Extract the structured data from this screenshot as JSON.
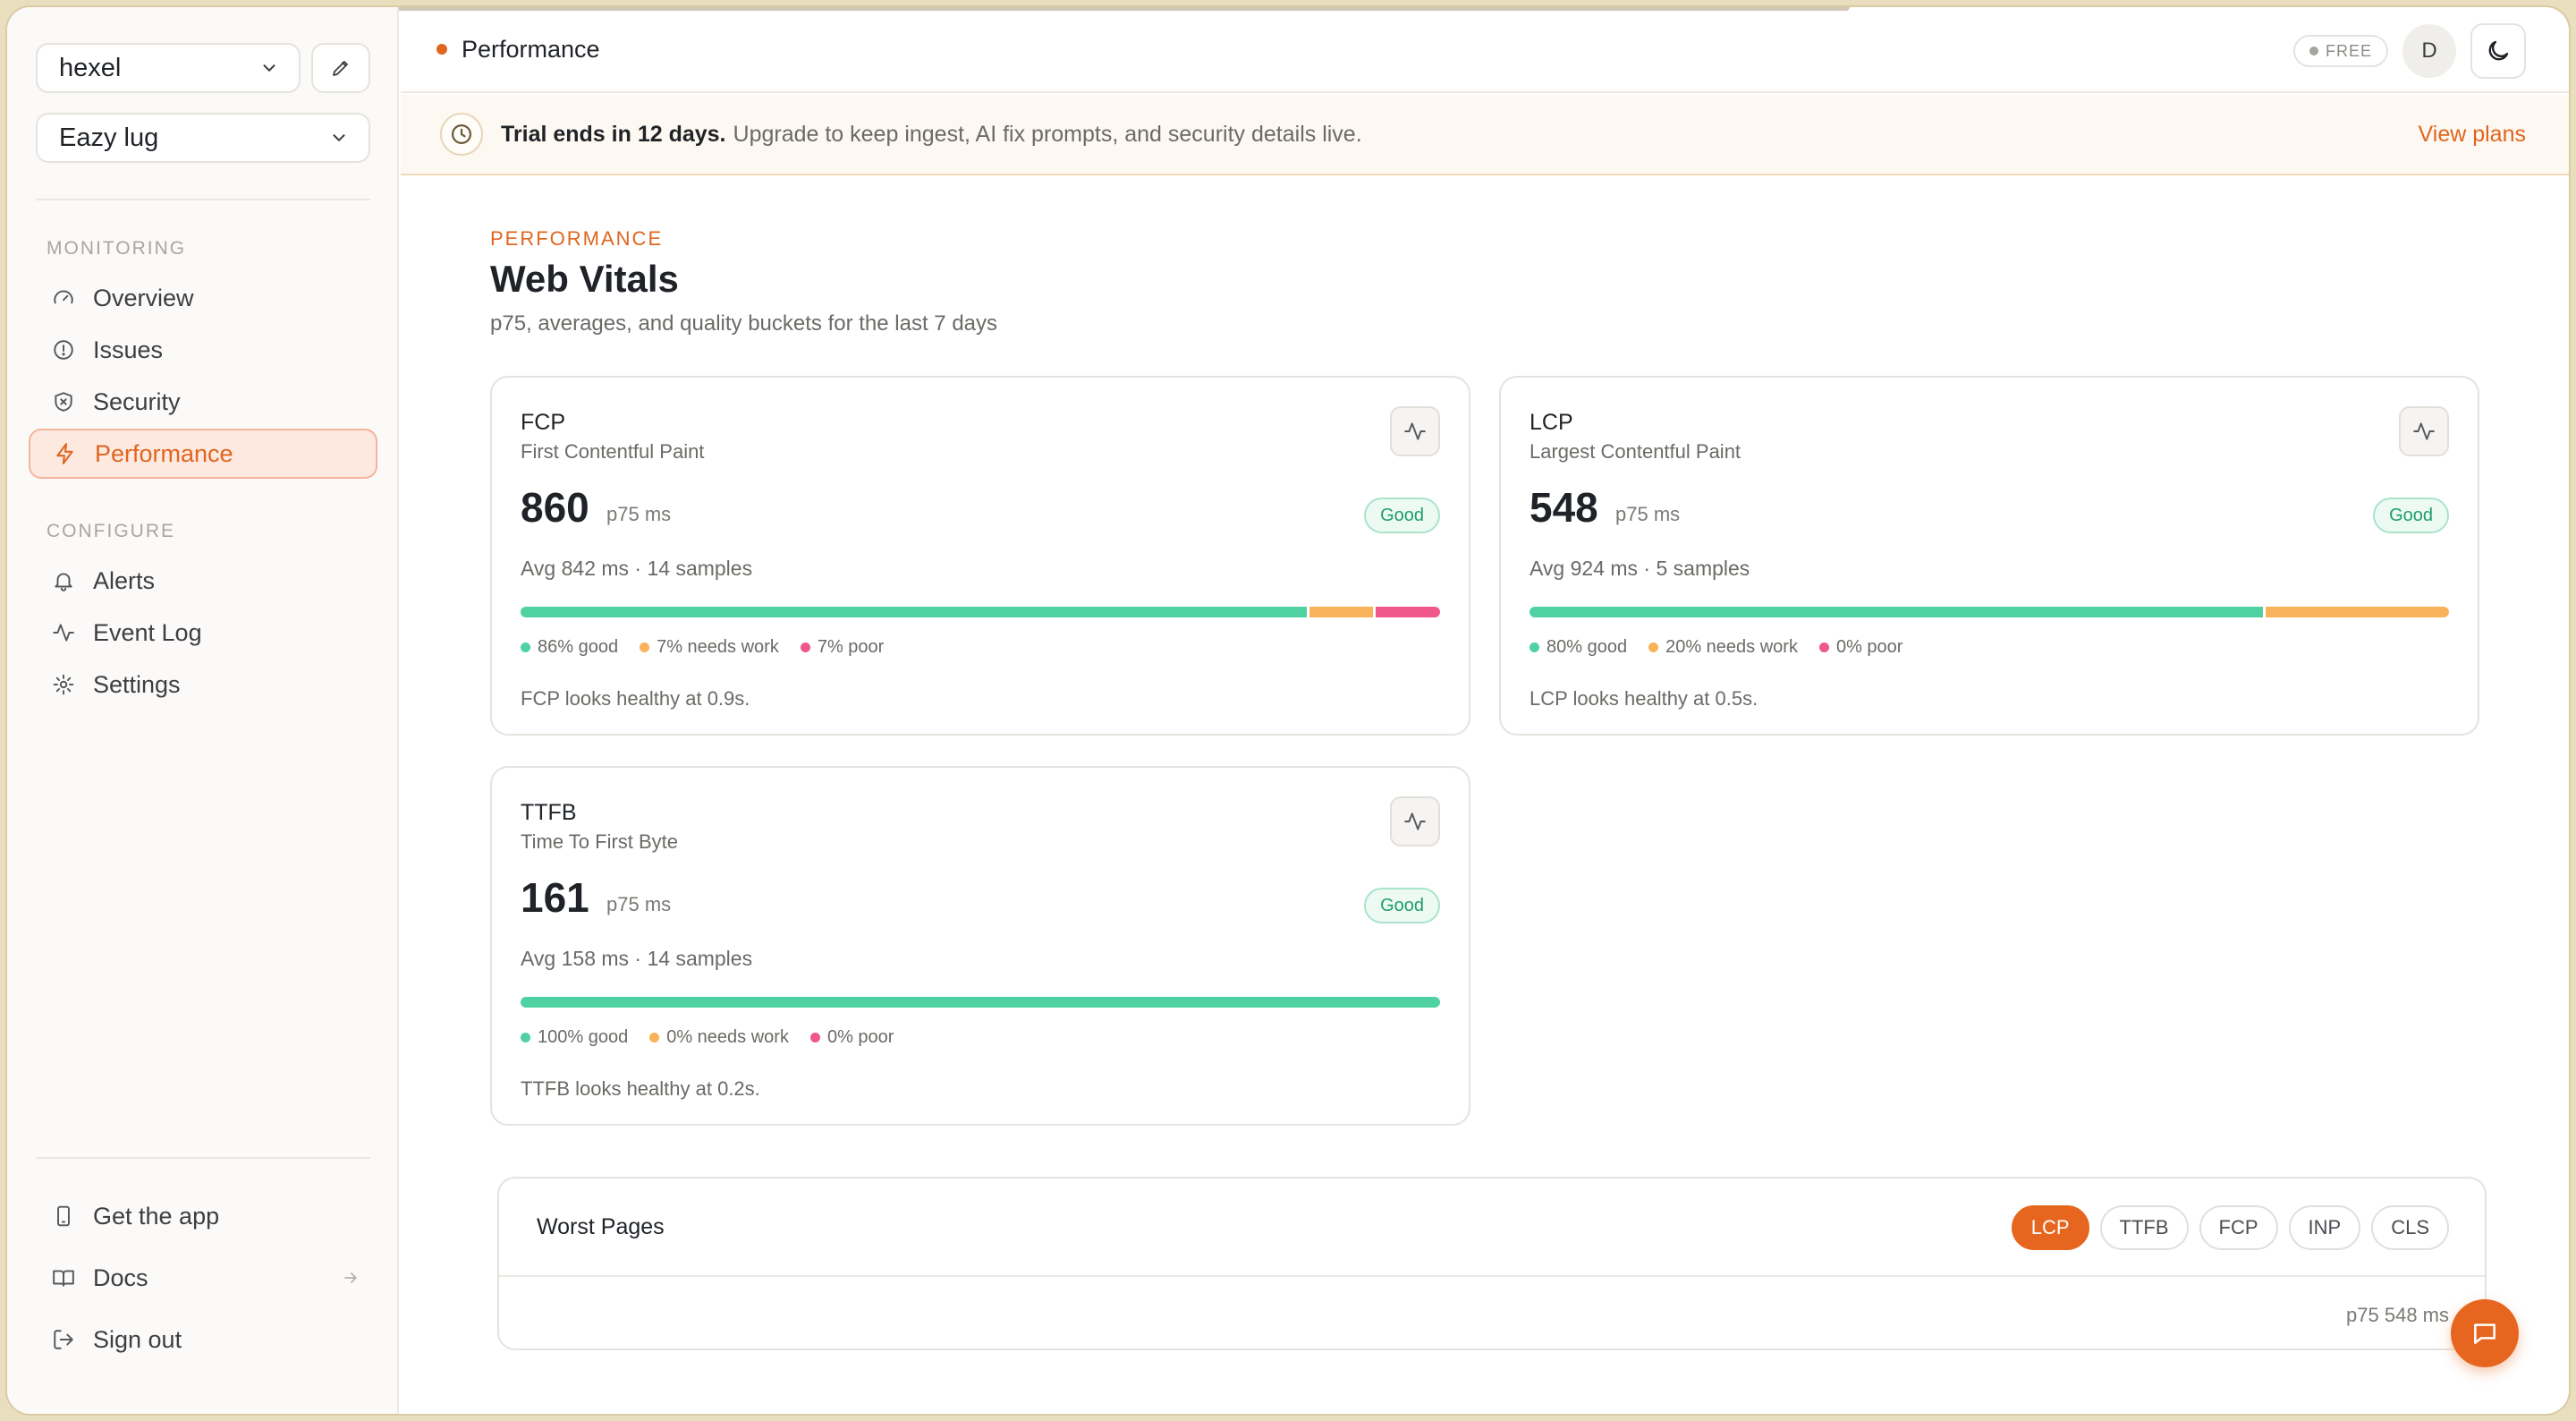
{
  "sidebar": {
    "workspace": "hexel",
    "project": "Eazy lug",
    "sections": {
      "monitoring": "MONITORING",
      "configure": "CONFIGURE"
    },
    "items": [
      {
        "label": "Overview",
        "icon": "gauge-icon"
      },
      {
        "label": "Issues",
        "icon": "alert-circle-icon"
      },
      {
        "label": "Security",
        "icon": "shield-icon"
      },
      {
        "label": "Performance",
        "icon": "bolt-icon"
      },
      {
        "label": "Alerts",
        "icon": "bell-icon"
      },
      {
        "label": "Event Log",
        "icon": "activity-icon"
      },
      {
        "label": "Settings",
        "icon": "gear-icon"
      }
    ],
    "bottom": [
      {
        "label": "Get the app",
        "icon": "phone-icon"
      },
      {
        "label": "Docs",
        "icon": "book-icon"
      },
      {
        "label": "Sign out",
        "icon": "sign-out-icon"
      }
    ]
  },
  "header": {
    "breadcrumb": "Performance",
    "plan": "FREE",
    "avatar": "D"
  },
  "banner": {
    "strong": "Trial ends in 12 days.",
    "text": "Upgrade to keep ingest, AI fix prompts, and security details live.",
    "link": "View plans"
  },
  "main": {
    "eyebrow": "PERFORMANCE",
    "title": "Web Vitals",
    "subtitle": "p75, averages, and quality buckets for the last 7 days"
  },
  "cards": [
    {
      "abbr": "FCP",
      "name": "First Contentful Paint",
      "value": "860",
      "unit": "p75 ms",
      "badge": "Good",
      "avg": "Avg 842 ms · 14 samples",
      "good": 86,
      "needs": 7,
      "poor": 7,
      "legend_good": "86% good",
      "legend_needs": "7% needs work",
      "legend_poor": "7% poor",
      "note": "FCP looks healthy at 0.9s."
    },
    {
      "abbr": "LCP",
      "name": "Largest Contentful Paint",
      "value": "548",
      "unit": "p75 ms",
      "badge": "Good",
      "avg": "Avg 924 ms · 5 samples",
      "good": 80,
      "needs": 20,
      "poor": 0,
      "legend_good": "80% good",
      "legend_needs": "20% needs work",
      "legend_poor": "0% poor",
      "note": "LCP looks healthy at 0.5s."
    },
    {
      "abbr": "TTFB",
      "name": "Time To First Byte",
      "value": "161",
      "unit": "p75 ms",
      "badge": "Good",
      "avg": "Avg 158 ms · 14 samples",
      "good": 100,
      "needs": 0,
      "poor": 0,
      "legend_good": "100% good",
      "legend_needs": "0% needs work",
      "legend_poor": "0% poor",
      "note": "TTFB looks healthy at 0.2s."
    }
  ],
  "worst_pages": {
    "title": "Worst Pages",
    "filters": [
      "LCP",
      "TTFB",
      "FCP",
      "INP",
      "CLS"
    ],
    "active_filter": "LCP",
    "meta": "p75 548 ms"
  },
  "colors": {
    "accent": "#e0651f",
    "good": "#4fd1a1",
    "needs_work": "#f8b35a",
    "poor": "#f0578b"
  }
}
